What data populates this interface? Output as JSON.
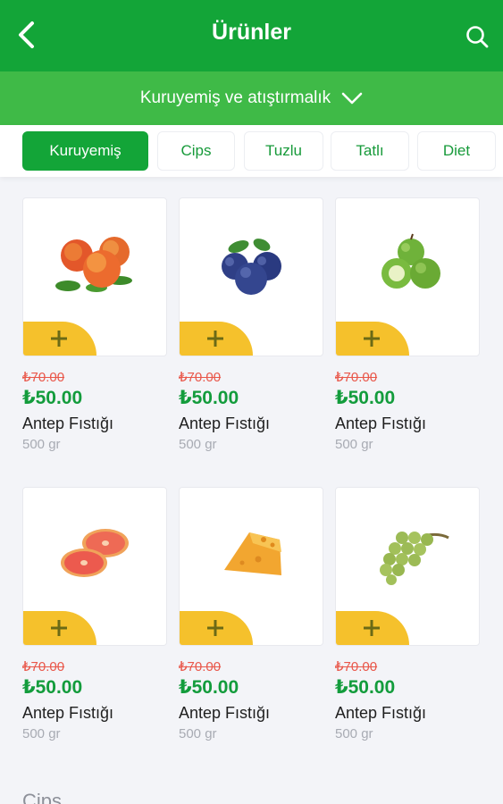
{
  "header": {
    "title": "Ürünler",
    "back_icon": "chevron-left-icon",
    "search_icon": "search-icon",
    "color": "#13a538"
  },
  "category": {
    "label": "Kuruyemiş ve atıştırmalık",
    "icon": "chevron-down-icon",
    "color": "#3fba47"
  },
  "tabs": [
    {
      "label": "Kuruyemiş",
      "active": true
    },
    {
      "label": "Cips",
      "active": false
    },
    {
      "label": "Tuzlu",
      "active": false
    },
    {
      "label": "Tatlı",
      "active": false
    },
    {
      "label": "Diet",
      "active": false
    }
  ],
  "products": [
    {
      "image": "peaches",
      "old_price": "₺70.00",
      "price": "₺50.00",
      "name": "Antep Fıstığı",
      "weight": "500 gr"
    },
    {
      "image": "blueberries",
      "old_price": "₺70.00",
      "price": "₺50.00",
      "name": "Antep Fıstığı",
      "weight": "500 gr"
    },
    {
      "image": "green-apples",
      "old_price": "₺70.00",
      "price": "₺50.00",
      "name": "Antep Fıstığı",
      "weight": "500 gr"
    },
    {
      "image": "grapefruit",
      "old_price": "₺70.00",
      "price": "₺50.00",
      "name": "Antep Fıstığı",
      "weight": "500 gr"
    },
    {
      "image": "cheese",
      "old_price": "₺70.00",
      "price": "₺50.00",
      "name": "Antep Fıstığı",
      "weight": "500 gr"
    },
    {
      "image": "green-grapes",
      "old_price": "₺70.00",
      "price": "₺50.00",
      "name": "Antep Fıstığı",
      "weight": "500 gr"
    }
  ],
  "add_button": {
    "icon": "plus-icon",
    "color": "#f5c12c"
  },
  "next_section": {
    "label": "Cips"
  }
}
